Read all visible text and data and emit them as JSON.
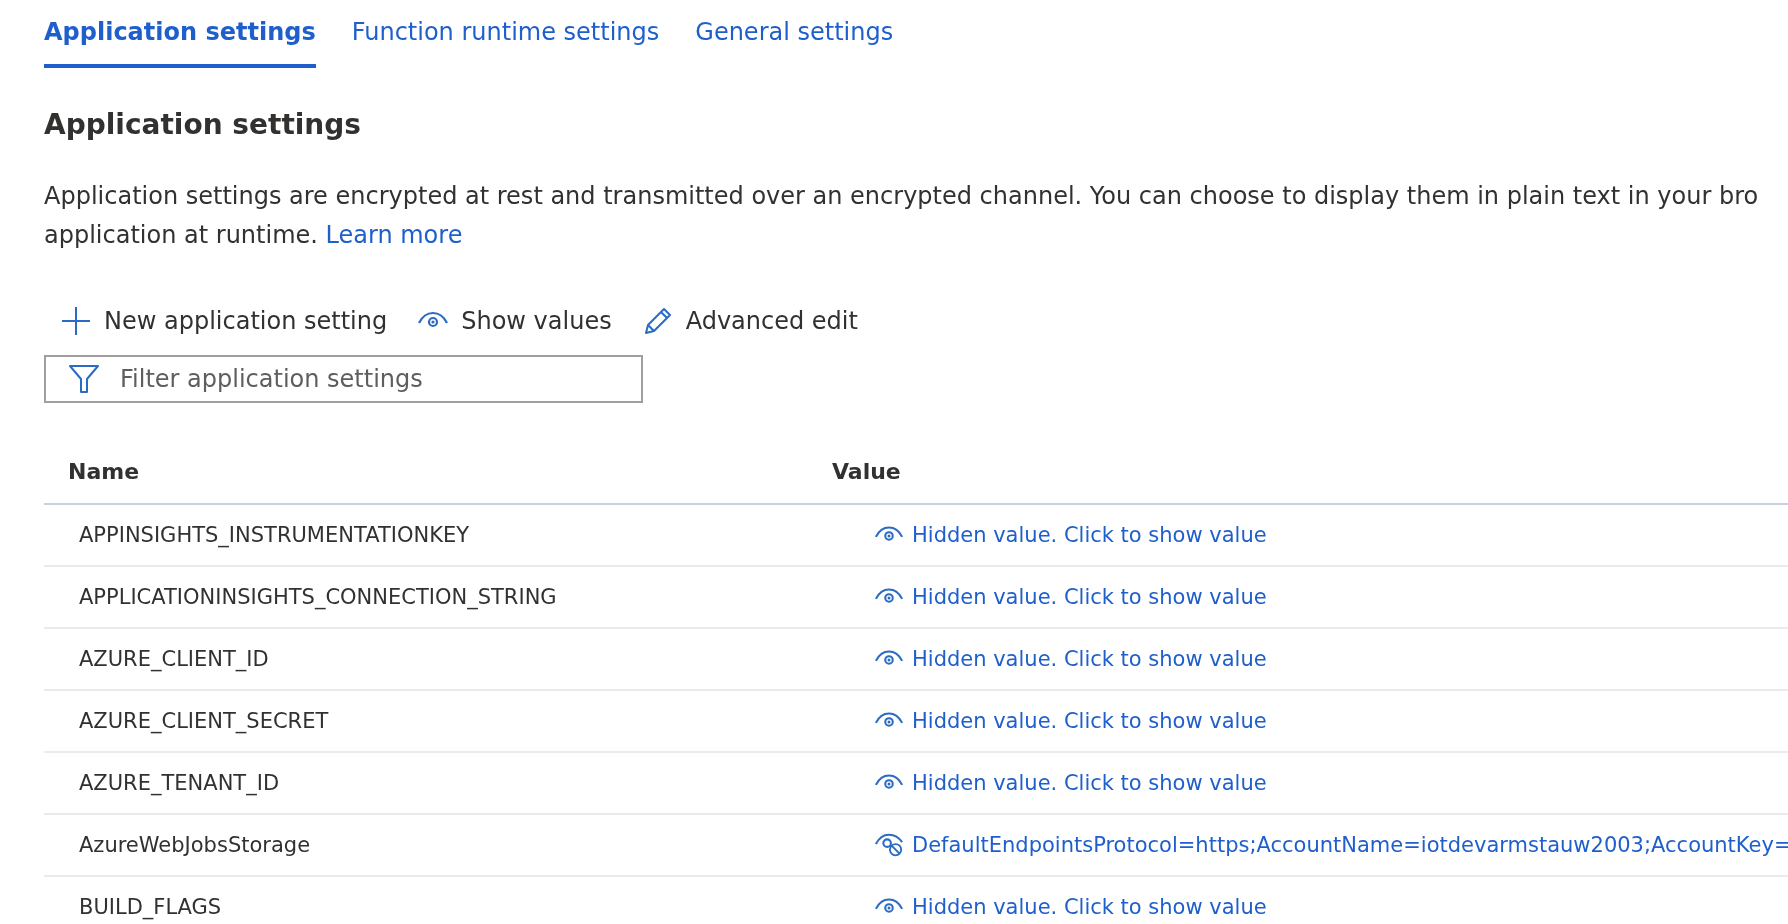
{
  "tabs": [
    {
      "label": "Application settings",
      "selected": true
    },
    {
      "label": "Function runtime settings",
      "selected": false
    },
    {
      "label": "General settings",
      "selected": false
    }
  ],
  "section": {
    "title": "Application settings",
    "description_line_1": "Application settings are encrypted at rest and transmitted over an encrypted channel. You can choose to display them in plain text in your bro",
    "description_line_2": "application at runtime.",
    "link": "Learn more"
  },
  "toolbar": [
    {
      "kind": "add",
      "label": "New application setting"
    },
    {
      "kind": "show",
      "label": "Show values"
    },
    {
      "kind": "edit",
      "label": "Advanced edit"
    }
  ],
  "filter": {
    "placeholder": "Filter application settings"
  },
  "table": {
    "columns": [
      "Name",
      "Value"
    ],
    "rows": [
      {
        "name": "APPINSIGHTS_INSTRUMENTATIONKEY",
        "value": "Hidden value. Click to show value",
        "hidden": true
      },
      {
        "name": "APPLICATIONINSIGHTS_CONNECTION_STRING",
        "value": "Hidden value. Click to show value",
        "hidden": true
      },
      {
        "name": "AZURE_CLIENT_ID",
        "value": "Hidden value. Click to show value",
        "hidden": true
      },
      {
        "name": "AZURE_CLIENT_SECRET",
        "value": "Hidden value. Click to show value",
        "hidden": true
      },
      {
        "name": "AZURE_TENANT_ID",
        "value": "Hidden value. Click to show value",
        "hidden": true
      },
      {
        "name": "AzureWebJobsStorage",
        "value": "DefaultEndpointsProtocol=https;AccountName=iotdevarmstauw2003;AccountKey=",
        "hidden": false
      },
      {
        "name": "BUILD_FLAGS",
        "value": "Hidden value. Click to show value",
        "hidden": true
      }
    ]
  }
}
